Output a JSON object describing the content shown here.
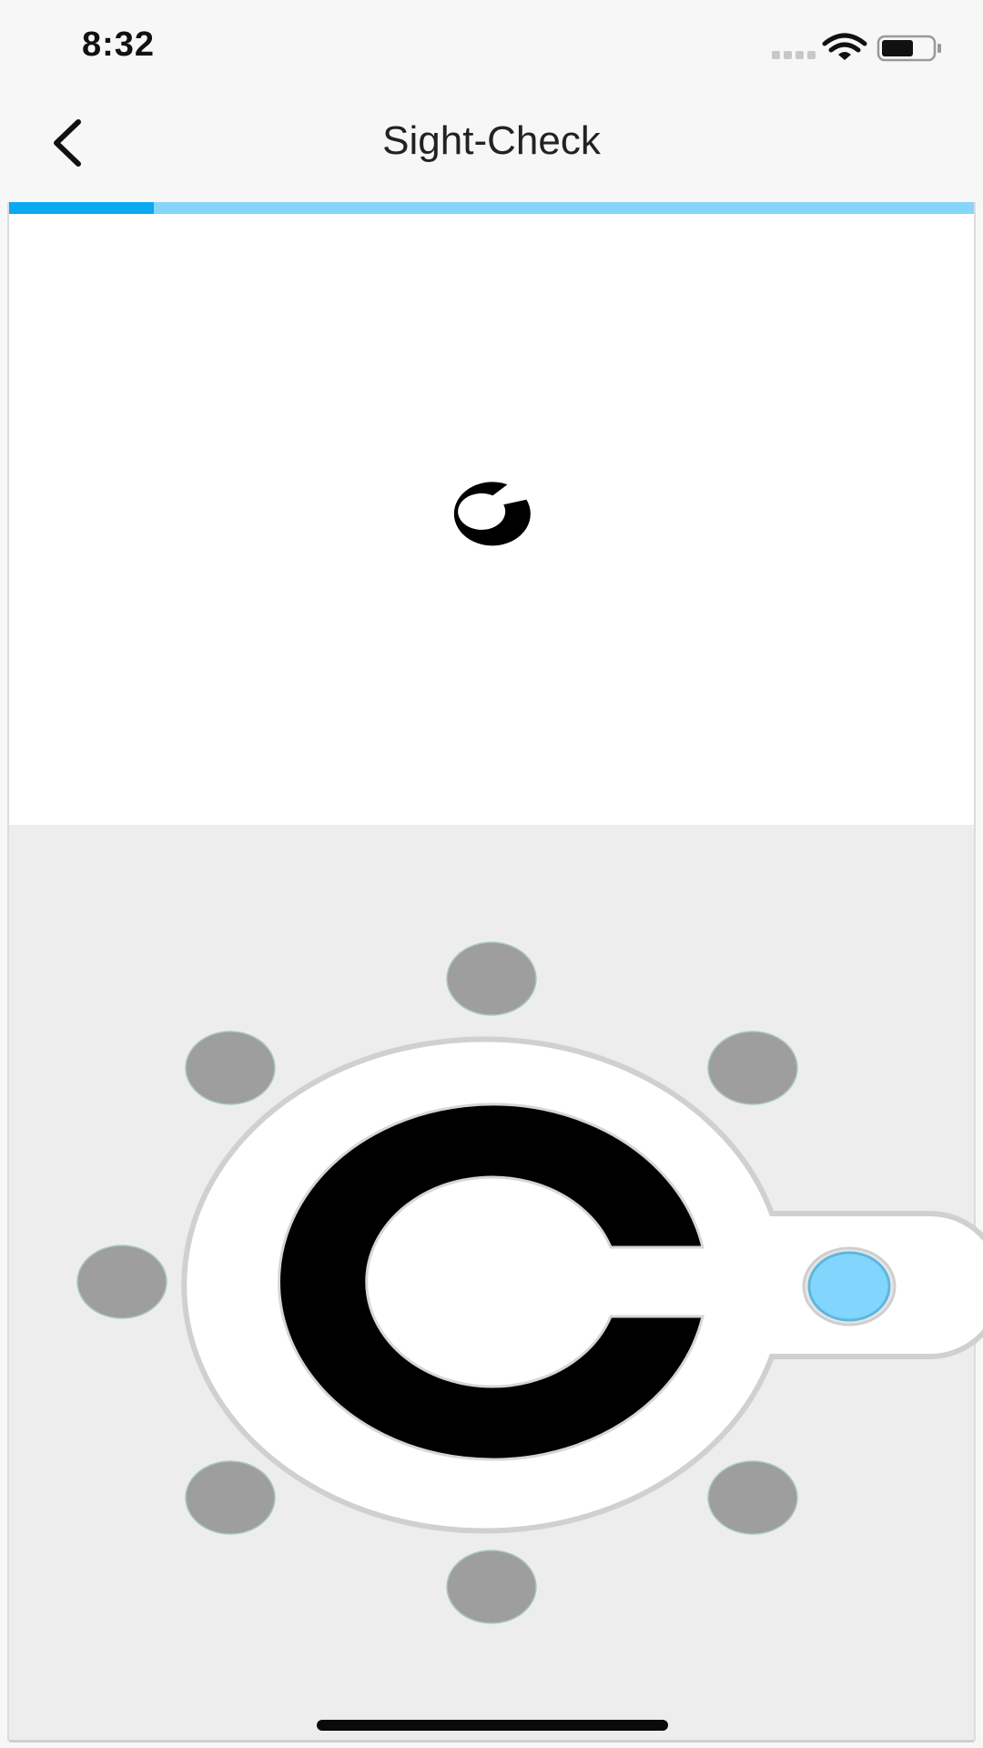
{
  "status_bar": {
    "time": "8:32",
    "icons": [
      "cellular-signal-icon",
      "wifi-icon",
      "battery-icon"
    ]
  },
  "nav": {
    "back_icon": "chevron-left-icon",
    "title": "Sight-Check"
  },
  "progress": {
    "value": 0.15
  },
  "target": {
    "optotype": "landolt-c",
    "gap_direction": "up-right"
  },
  "dial": {
    "directions": [
      "up",
      "up-right",
      "right",
      "down-right",
      "down",
      "down-left",
      "left",
      "up-left"
    ],
    "selected": "right"
  },
  "colors": {
    "accent": "#0aa9f0",
    "accent_light": "#86d5fb",
    "selected_dot": "#82d6fd",
    "direction_dot": "#9e9e9e",
    "panel_gray": "#ededed"
  }
}
